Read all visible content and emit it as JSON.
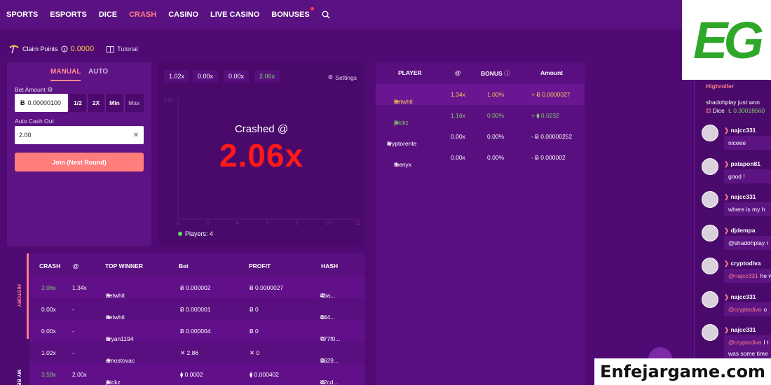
{
  "nav": {
    "items": [
      "SPORTS",
      "ESPORTS",
      "DICE",
      "CRASH",
      "CASINO",
      "LIVE CASINO",
      "BONUSES"
    ],
    "active": "CRASH",
    "search_icon": "search-icon"
  },
  "claim": {
    "label": "Claim Points",
    "amount": "0.0000",
    "tutorial": "Tutorial"
  },
  "bet": {
    "tabs": [
      "MANUAL",
      "AUTO"
    ],
    "bet_amount_label": "Bet Amount",
    "bet_amount_value": "0.00000100",
    "quick_buttons": [
      "1/2",
      "2X",
      "Min",
      "Max"
    ],
    "auto_cashout_label": "Auto Cash Out",
    "auto_cashout_value": "2.00",
    "join_label": "Join (Next Round)"
  },
  "graph": {
    "recent_multipliers": [
      "1.02x",
      "0.00x",
      "0.00x",
      "2.06x"
    ],
    "settings_label": "Settings",
    "crashed_label": "Crashed @",
    "crashed_value": "2.06x",
    "axis_y_tick": "2.0x",
    "axis_x_ticks": [
      "0",
      "2",
      "4",
      "6",
      "8",
      "10",
      "12"
    ],
    "players_label": "Players: 4"
  },
  "players_table": {
    "headers": [
      "PLAYER",
      "@",
      "BONUS",
      "Amount"
    ],
    "rows": [
      {
        "player": "betwhit",
        "at": "1.34x",
        "bonus": "1.00%",
        "amount": "+ Ƀ 0.0000027",
        "color": "#ffc94d"
      },
      {
        "player": "jkickz",
        "at": "1.16x",
        "bonus": "0.00%",
        "amount": "+ ⧫ 0.0232",
        "color": "#7fd46e"
      },
      {
        "player": "kryptorente",
        "at": "0.00x",
        "bonus": "0.00%",
        "amount": "- Ƀ 0.00000252",
        "color": "#ffffff"
      },
      {
        "player": "thenyx",
        "at": "0.00x",
        "bonus": "0.00%",
        "amount": "- Ƀ 0.000002",
        "color": "#ffffff"
      }
    ]
  },
  "history": {
    "side_tabs": [
      "HISTORY",
      "MY BETS"
    ],
    "headers": [
      "CRASH",
      "@",
      "TOP WINNER",
      "Bet",
      "PROFIT",
      "HASH"
    ],
    "rows": [
      {
        "crash": "2.06x",
        "at": "1.34x",
        "winner": "betwhit",
        "bet": "Ƀ 0.000002",
        "profit": "Ƀ 0.0000027",
        "hash": "4ba...",
        "crash_color": "#7fd46e"
      },
      {
        "crash": "0.00x",
        "at": "-",
        "winner": "betwhit",
        "bet": "Ƀ 0.000001",
        "profit": "Ƀ 0",
        "hash": "444...",
        "crash_color": "#ffffff"
      },
      {
        "crash": "0.00x",
        "at": "-",
        "winner": "bryan1194",
        "bet": "Ƀ 0.000004",
        "profit": "Ƀ 0",
        "hash": "777f0...",
        "crash_color": "#ffffff"
      },
      {
        "crash": "1.02x",
        "at": "-",
        "winner": "dmostovac",
        "bet": "✕ 2.86",
        "profit": "✕ 0",
        "hash": "3629...",
        "crash_color": "#ffffff"
      },
      {
        "crash": "3.59x",
        "at": "2.00x",
        "winner": "jkickz",
        "bet": "⧫ 0.0002",
        "profit": "⧫ 0.000402",
        "hash": "d2cd...",
        "crash_color": "#7fd46e"
      }
    ]
  },
  "chat": {
    "highroller_label": "Highroller",
    "highroller_text": "shadohplay just won",
    "highroller_game": "Dice",
    "highroller_amount": "Ł 0.30018560",
    "messages": [
      {
        "user": "najcc331",
        "text": "niceee",
        "mention": ""
      },
      {
        "user": "patapon81",
        "text": "good !",
        "mention": ""
      },
      {
        "user": "najcc331",
        "text": "where is my h",
        "mention": ""
      },
      {
        "user": "djdempa",
        "text": "@shadohplay r",
        "mention": ""
      },
      {
        "user": "cryptodiva",
        "text": "he w",
        "mention": "@najcc331"
      },
      {
        "user": "najcc331",
        "text": "o",
        "mention": "@cryptodiva"
      },
      {
        "user": "najcc331",
        "text": "I t",
        "mention": "@cryptodiva"
      },
      {
        "user": "",
        "text": "was some time",
        "mention": ""
      }
    ]
  },
  "watermark": {
    "logo": "EG",
    "site": "Enfejargame.com"
  },
  "colors": {
    "bg": "#4f0b73",
    "accent": "#ff7c8a",
    "gold": "#ffc94d",
    "green": "#7fd46e",
    "red": "#ff1919"
  }
}
